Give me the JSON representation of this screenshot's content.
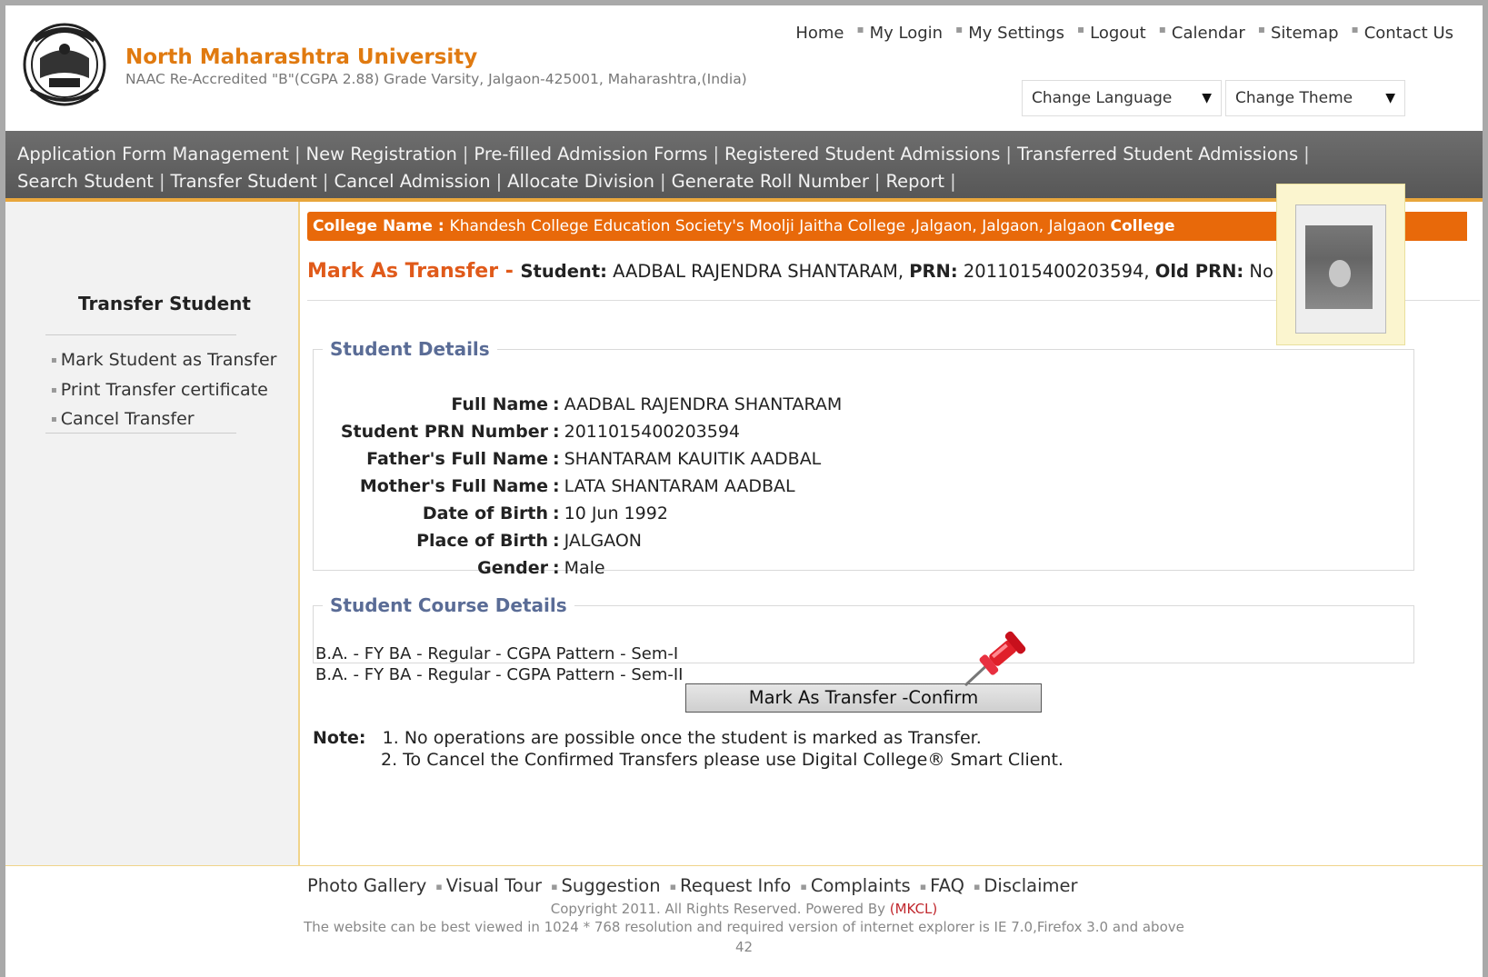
{
  "header": {
    "university_name": "North Maharashtra University",
    "subtitle": "NAAC Re-Accredited \"B\"(CGPA 2.88) Grade Varsity, Jalgaon-425001, Maharashtra,(India)",
    "top_links": [
      "Home",
      "My Login",
      "My Settings",
      "Logout",
      "Calendar",
      "Sitemap",
      "Contact Us"
    ],
    "change_language": "Change Language",
    "change_theme": "Change Theme"
  },
  "nav": {
    "row1": [
      "Application Form Management",
      "New Registration",
      "Pre-filled Admission Forms",
      "Registered Student Admissions",
      "Transferred Student Admissions"
    ],
    "row2": [
      "Search Student",
      "Transfer Student",
      "Cancel Admission",
      "Allocate Division",
      "Generate Roll Number",
      "Report"
    ]
  },
  "sidebar": {
    "title": "Transfer Student",
    "items": [
      "Mark Student as Transfer",
      "Print Transfer certificate",
      "Cancel Transfer"
    ]
  },
  "college_bar": {
    "label": "College Name : ",
    "value": "Khandesh College Education Society's Moolji Jaitha College ,Jalgaon, Jalgaon, Jalgaon ",
    "trailing_label": "College"
  },
  "title_line": {
    "heading": "Mark As Transfer",
    "dash": " - ",
    "student_label": "Student:",
    "student_value": " AADBAL RAJENDRA SHANTARAM, ",
    "prn_label": "PRN:",
    "prn_value": " 2011015400203594, ",
    "old_prn_label": "Old PRN:",
    "old_prn_value": " No"
  },
  "student_details": {
    "legend": "Student Details",
    "fields": [
      {
        "label": "Full Name",
        "value": "AADBAL RAJENDRA SHANTARAM"
      },
      {
        "label": "Student PRN Number",
        "value": "2011015400203594"
      },
      {
        "label": "Father's Full Name",
        "value": "SHANTARAM KAUITIK AADBAL"
      },
      {
        "label": "Mother's Full Name",
        "value": "LATA SHANTARAM AADBAL"
      },
      {
        "label": "Date of Birth",
        "value": "10 Jun 1992"
      },
      {
        "label": "Place of Birth",
        "value": "JALGAON"
      },
      {
        "label": "Gender",
        "value": "Male"
      }
    ]
  },
  "course_details": {
    "legend": "Student Course Details",
    "lines": [
      "B.A. - FY BA - Regular - CGPA Pattern - Sem-I",
      "B.A. - FY BA - Regular - CGPA Pattern - Sem-II"
    ]
  },
  "confirm_button": "Mark As Transfer -Confirm",
  "note": {
    "label": "Note:",
    "lines": [
      "1. No operations are possible once the student is marked as Transfer.",
      "2. To Cancel the Confirmed Transfers please use Digital College® Smart Client."
    ]
  },
  "footer": {
    "links": [
      "Photo Gallery",
      "Visual Tour",
      "Suggestion",
      "Request Info",
      "Complaints",
      "FAQ",
      "Disclaimer"
    ],
    "copyright": "Copyright 2011. All Rights Reserved. Powered By ",
    "mkcl": "(MKCL)",
    "best_viewed": "The website can be best viewed in 1024 * 768 resolution and required version of internet explorer is IE 7.0,Firefox 3.0 and above",
    "page_number": "42"
  },
  "colors": {
    "accent_orange": "#e8690a",
    "title_orange": "#e05a1a",
    "legend_blue": "#5a6c96",
    "nav_gray": "#626262"
  }
}
